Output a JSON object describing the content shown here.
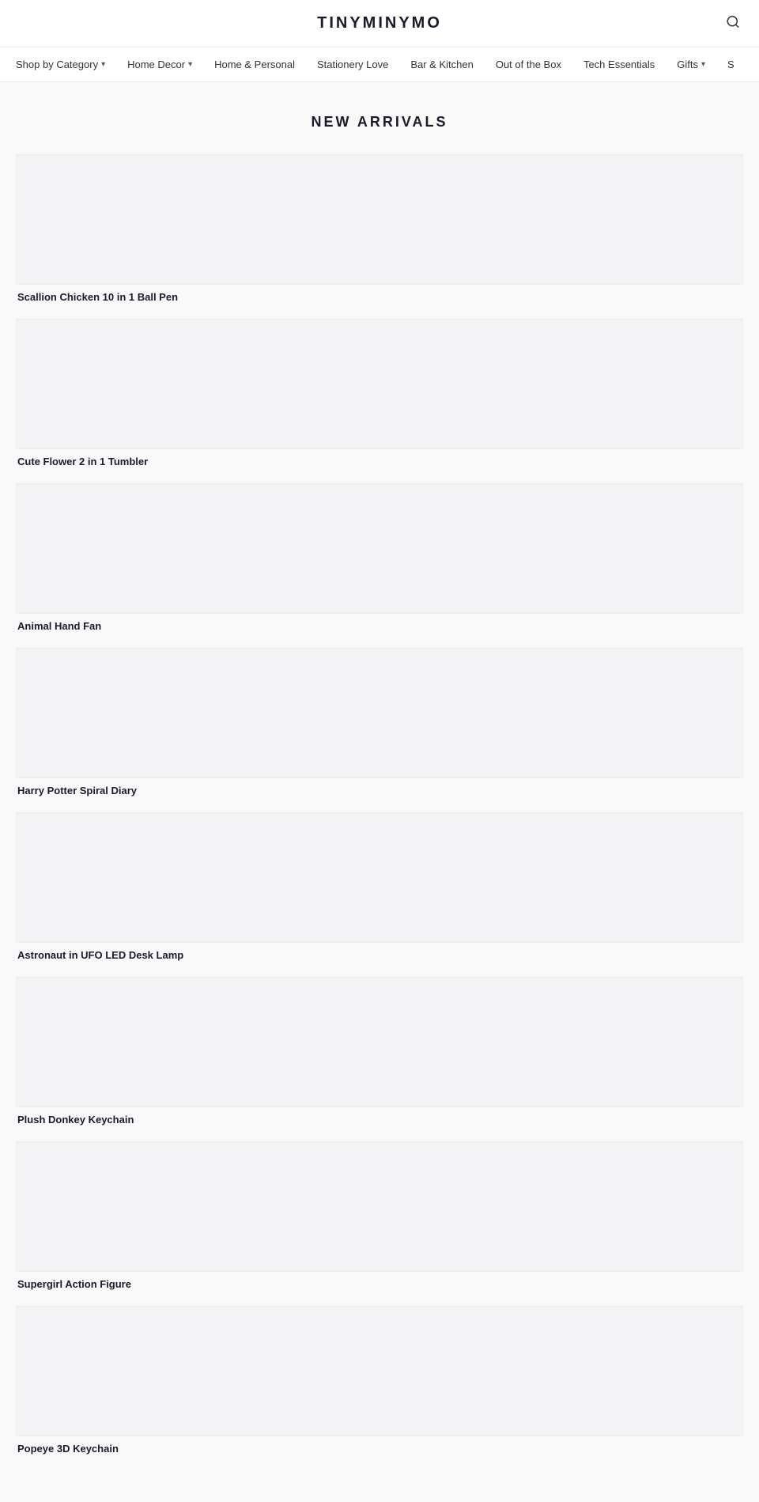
{
  "header": {
    "logo": "TINYMINYMO",
    "search_icon": "🔍"
  },
  "nav": {
    "items": [
      {
        "label": "Shop by Category",
        "has_chevron": true
      },
      {
        "label": "Home Decor",
        "has_chevron": true
      },
      {
        "label": "Home & Personal",
        "has_chevron": false
      },
      {
        "label": "Stationery Love",
        "has_chevron": false
      },
      {
        "label": "Bar & Kitchen",
        "has_chevron": false
      },
      {
        "label": "Out of the Box",
        "has_chevron": false
      },
      {
        "label": "Tech Essentials",
        "has_chevron": false
      },
      {
        "label": "Gifts",
        "has_chevron": true
      },
      {
        "label": "S",
        "has_chevron": false
      }
    ]
  },
  "main": {
    "section_title": "NEW ARRIVALS",
    "products": [
      {
        "name": "Scallion Chicken 10 in 1 Ball Pen"
      },
      {
        "name": "Cute Flower 2 in 1 Tumbler"
      },
      {
        "name": "Animal Hand Fan"
      },
      {
        "name": "Harry Potter Spiral Diary"
      },
      {
        "name": "Astronaut in UFO LED Desk Lamp"
      },
      {
        "name": "Plush Donkey Keychain"
      },
      {
        "name": "Supergirl Action Figure"
      },
      {
        "name": "Popeye 3D Keychain"
      }
    ]
  }
}
